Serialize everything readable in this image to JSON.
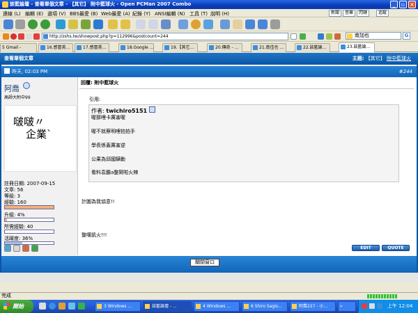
{
  "window": {
    "title": "該藍論壇 - 查看單個文章 - 【其它】 附中藍球火 - Open PCMan 2007 Combo"
  },
  "menu": {
    "items": [
      "連線 (L)",
      "編輯 (E)",
      "選項 (V)",
      "BBS最愛 (B)",
      "Web最愛 (A)",
      "紀錄 (Y)",
      "ANSI編輯 (N)",
      "工具 (T)",
      "說明 (H)"
    ],
    "right_tabs": [
      "新聞",
      "音樂",
      "閃鏈",
      "追蹤"
    ]
  },
  "address_bar": {
    "url": "http://zshs.tw/showpost.php?p=112996&postcount=244"
  },
  "search": {
    "value": "南加也"
  },
  "tabs": [
    {
      "label": "5 Gmail -"
    },
    {
      "label": "16.感冒英..."
    },
    {
      "label": "17.感冒英..."
    },
    {
      "label": "18.Google ..."
    },
    {
      "label": "19.【其它..."
    },
    {
      "label": "20.傳奇 - ..."
    },
    {
      "label": "21.南佳也 ..."
    },
    {
      "label": "22.該藍論..."
    },
    {
      "label": "23.該藍論..."
    }
  ],
  "page": {
    "header_title": "查看單個文章",
    "header_subject_label": "主題:",
    "header_subject_category": "【其它】",
    "header_subject_name": "附中藍球火"
  },
  "post": {
    "date": "昨天, 02:03 PM",
    "number": "#244",
    "title": "回覆: 附中藍球火",
    "quote_label": "引用:",
    "quote_author_prefix": "作者:",
    "quote_author": "twichiro5151",
    "quote_lines": [
      "喔那哩卡厲害喔",
      "喔不就蔡明哩拍拍手",
      "學長係蓋厲害逆",
      "公果為邱國驊勳",
      "看料袁膽a整鬧啦火辣"
    ],
    "body_lines": [
      "計圖為我協意!!",
      "整嘆凱火!!!"
    ],
    "edit_label": "EDIT",
    "quote_button_label": "QUOTE"
  },
  "user": {
    "name": "阿喬",
    "title": "高師大附中99",
    "avatar_lines": [
      "啵啵〃",
      "企業ˋ"
    ],
    "registered": "註冊日期: 2007-09-15",
    "posts": "文章: 56",
    "level": "等級: 3",
    "exp": "經驗: 160",
    "upgrade": "升級: 4%",
    "needed": "所需經驗: 40",
    "activity": "活躍度: 36%",
    "exp_fill": 1.0,
    "upgrade_fill": 0.04,
    "activity_fill": 0.36
  },
  "footer": {
    "close_window": "關閉窗口"
  },
  "statusbar": {
    "text": "完成"
  },
  "taskbar": {
    "start": "開始",
    "buttons": [
      {
        "label": "3 Windows ..."
      },
      {
        "label": "該藍論壇 - ..."
      },
      {
        "label": "4 Windows ..."
      },
      {
        "label": "6 Shiro Sagis..."
      },
      {
        "label": "阿喬227 - 小..."
      }
    ],
    "clock": "上午 12:04"
  },
  "colors": {
    "titlebar": "#0a3fc0",
    "header_blue": "#0a56a8",
    "exp_bar": "#f3b07a",
    "upgrade_bar": "#f3b07a",
    "activity_bar": "#a8c2f0"
  }
}
